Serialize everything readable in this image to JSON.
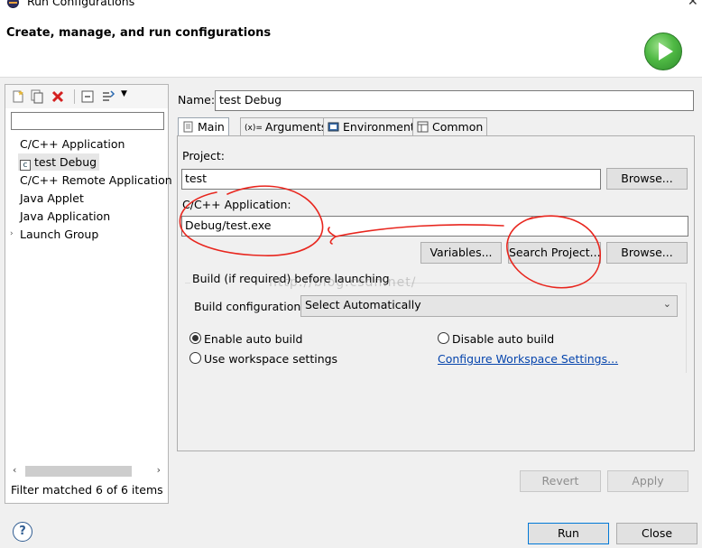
{
  "window": {
    "title": "Run Configurations"
  },
  "header": {
    "title": "Create, manage, and run configurations"
  },
  "left": {
    "filter_placeholder": "",
    "tree": [
      {
        "label": "C/C++ Application",
        "type": "folder"
      },
      {
        "label": "test Debug",
        "type": "config",
        "icon_text": "c",
        "selected": true
      },
      {
        "label": "C/C++ Remote Application",
        "type": "folder"
      },
      {
        "label": "Java Applet",
        "type": "folder"
      },
      {
        "label": "Java Application",
        "type": "folder"
      },
      {
        "label": "Launch Group",
        "type": "folder",
        "collapsed": true
      }
    ],
    "status": "Filter matched 6 of 6 items"
  },
  "name": {
    "label": "Name:",
    "value": "test Debug"
  },
  "tabs": [
    {
      "label": "Main",
      "icon": "main-tab-icon",
      "active": true
    },
    {
      "label": "Arguments",
      "icon": "arguments-icon"
    },
    {
      "label": "Environment",
      "icon": "environment-icon"
    },
    {
      "label": "Common",
      "icon": "common-icon"
    }
  ],
  "main": {
    "project_label": "Project:",
    "project_value": "test",
    "browse_label": "Browse...",
    "app_label": "C/C++ Application:",
    "app_value": "Debug/test.exe",
    "variables_label": "Variables...",
    "search_project_label": "Search Project...",
    "browse2_label": "Browse...",
    "build_group_label": "Build (if required) before launching",
    "build_config_label": "Build configuration:",
    "build_config_value": "Select Automatically",
    "enable_auto_build": "Enable auto build",
    "disable_auto_build": "Disable auto build",
    "use_workspace": "Use workspace settings",
    "configure_link": "Configure Workspace Settings...",
    "selected_option": "enable_auto_build"
  },
  "watermark": "http://blog.csdn.net/",
  "buttons": {
    "revert": "Revert",
    "apply": "Apply",
    "run": "Run",
    "close": "Close",
    "help": "?"
  },
  "colors": {
    "annotation": "#e8261e",
    "link": "#0645ad",
    "focus": "#0078d7"
  }
}
